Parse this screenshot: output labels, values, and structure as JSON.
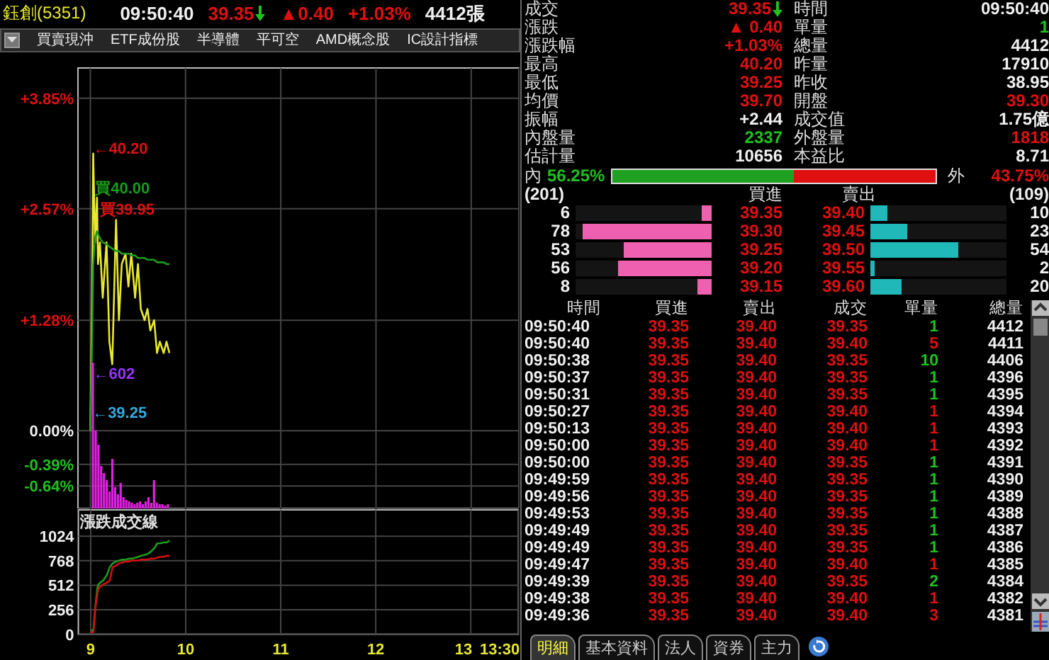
{
  "header": {
    "name": "鈺創(5351)",
    "time": "09:50:40",
    "price": "39.35",
    "falling": true,
    "change": "▲0.40",
    "change_pct": "+1.03%",
    "volume": "4412張"
  },
  "toolbar": [
    "買賣現沖",
    "ETF成份股",
    "半導體",
    "平可空",
    "AMD概念股",
    "IC設計指標"
  ],
  "price_chart": {
    "chart_data": {
      "type": "line",
      "grid": true,
      "x": [
        9,
        9.02,
        9.03,
        9.05,
        9.07,
        9.08,
        9.1,
        9.13,
        9.17,
        9.2,
        9.23,
        9.27,
        9.3,
        9.33,
        9.37,
        9.4,
        9.43,
        9.47,
        9.5,
        9.53,
        9.57,
        9.6,
        9.63,
        9.67,
        9.7,
        9.73,
        9.77,
        9.8,
        9.83
      ],
      "xlim": [
        8.87,
        13.5
      ],
      "ylim": [
        -0.9,
        4.2
      ],
      "yticks": [
        {
          "value": 3.85,
          "label": "+3.85%"
        },
        {
          "value": 2.57,
          "label": "+2.57%"
        },
        {
          "value": 1.28,
          "label": "+1.28%"
        },
        {
          "value": 0,
          "label": "0.00%"
        },
        {
          "value": -0.39,
          "label": "-0.39%"
        },
        {
          "value": -0.64,
          "label": "-0.64%"
        }
      ],
      "series": [
        {
          "color": "#e8e830",
          "values": [
            0,
            1.67,
            3.21,
            2.18,
            2.7,
            1.93,
            2.18,
            1.54,
            2.18,
            1.03,
            0.77,
            2.44,
            1.28,
            1.93,
            2.05,
            1.67,
            2.05,
            1.54,
            1.93,
            1.41,
            1.28,
            1.41,
            1.16,
            1.28,
            0.9,
            1.03,
            0.9,
            1.03,
            0.9
          ]
        },
        {
          "color": "#1e9a1e",
          "values": [
            0,
            1.16,
            1.93,
            2.23,
            2.31,
            2.28,
            2.23,
            2.18,
            2.16,
            2.13,
            2.11,
            2.08,
            2.08,
            2.05,
            2.05,
            2.05,
            2.03,
            2.03,
            2,
            2,
            2,
            1.98,
            1.98,
            1.98,
            1.95,
            1.95,
            1.95,
            1.93,
            1.93
          ]
        }
      ],
      "annotations": [
        {
          "text": "←40.20",
          "x": 9.03,
          "y": 3.21
        },
        {
          "text": "買40.00",
          "x": 9.05,
          "y": 2.75
        },
        {
          "text": "買39.95",
          "x": 9.1,
          "y": 2.5
        },
        {
          "text": "←602",
          "x": 9.03,
          "y": 0.6
        },
        {
          "text": "←39.25",
          "x": 9.02,
          "y": 0.15
        }
      ]
    }
  },
  "flow_chart": {
    "chart_data": {
      "type": "line",
      "title": "漲跌成交線",
      "x": [
        9,
        9.02,
        9.03,
        9.05,
        9.07,
        9.08,
        9.1,
        9.13,
        9.17,
        9.2,
        9.23,
        9.27,
        9.3,
        9.33,
        9.37,
        9.4,
        9.43,
        9.47,
        9.5,
        9.53,
        9.57,
        9.6,
        9.63,
        9.67,
        9.7,
        9.73,
        9.77,
        9.8,
        9.83
      ],
      "xlim": [
        8.87,
        13.5
      ],
      "ylim": [
        0,
        1300
      ],
      "grid": true,
      "xticks": [
        9,
        10,
        11,
        12,
        13,
        {
          "value": 13.5,
          "label": "13:30"
        }
      ],
      "yticks": [
        0,
        256,
        512,
        768,
        1024
      ],
      "series": [
        {
          "color": "#1e9a1e",
          "values": [
            40,
            40,
            60,
            300,
            480,
            520,
            540,
            560,
            620,
            700,
            740,
            760,
            770,
            780,
            780,
            790,
            790,
            800,
            810,
            820,
            830,
            840,
            860,
            900,
            950,
            950,
            960,
            960,
            980
          ]
        },
        {
          "color": "#d01010",
          "values": [
            20,
            20,
            30,
            280,
            420,
            470,
            500,
            520,
            540,
            560,
            700,
            720,
            740,
            750,
            760,
            760,
            770,
            770,
            770,
            780,
            780,
            780,
            790,
            790,
            800,
            810,
            810,
            820,
            820
          ]
        }
      ]
    }
  },
  "quote": [
    {
      "label": "成交",
      "value": "39.35",
      "color": "#e01010",
      "falling": true
    },
    {
      "label": "漲跌",
      "value": "▲ 0.40",
      "color": "#e01010"
    },
    {
      "label": "漲跌幅",
      "value": "+1.03%",
      "color": "#e01010"
    },
    {
      "label": "最高",
      "value": "40.20",
      "color": "#e01010"
    },
    {
      "label": "最低",
      "value": "39.25",
      "color": "#e01010"
    },
    {
      "label": "均價",
      "value": "39.70",
      "color": "#e01010"
    },
    {
      "label": "振幅",
      "value": "+2.44",
      "color": "#f0f0f0"
    },
    {
      "label": "內盤量",
      "value": "2337",
      "color": "#20c020"
    },
    {
      "label": "估計量",
      "value": "10656",
      "color": "#f0f0f0"
    },
    {
      "label": "時間",
      "value": "09:50:40",
      "color": "#f0f0f0"
    },
    {
      "label": "單量",
      "value": "1",
      "color": "#20c020"
    },
    {
      "label": "總量",
      "value": "4412",
      "color": "#f0f0f0"
    },
    {
      "label": "昨量",
      "value": "17910",
      "color": "#f0f0f0"
    },
    {
      "label": "昨收",
      "value": "38.95",
      "color": "#f0f0f0"
    },
    {
      "label": "開盤",
      "value": "39.30",
      "color": "#e01010"
    },
    {
      "label": "成交值",
      "value": "1.75億",
      "color": "#f0f0f0"
    },
    {
      "label": "外盤量",
      "value": "1818",
      "color": "#e01010"
    },
    {
      "label": "本益比",
      "value": "8.71",
      "color": "#f0f0f0"
    }
  ],
  "ratio": {
    "in_label": "內",
    "in_pct": "56.25%",
    "out_label": "外",
    "out_pct": "43.75%",
    "level": 0.5625
  },
  "order_book": {
    "bid_total": "(201)",
    "bid_label": "買進",
    "ask_label": "賣出",
    "ask_total": "(109)",
    "rows": [
      {
        "bid": {
          "qty": "6",
          "price": "39.35",
          "level": 0.07
        },
        "ask": {
          "qty": "10",
          "price": "39.40",
          "level": 0.12
        }
      },
      {
        "bid": {
          "qty": "78",
          "price": "39.30",
          "level": 0.95
        },
        "ask": {
          "qty": "23",
          "price": "39.45",
          "level": 0.27
        }
      },
      {
        "bid": {
          "qty": "53",
          "price": "39.25",
          "level": 0.65
        },
        "ask": {
          "qty": "54",
          "price": "39.50",
          "level": 0.65
        }
      },
      {
        "bid": {
          "qty": "56",
          "price": "39.20",
          "level": 0.69
        },
        "ask": {
          "qty": "2",
          "price": "39.55",
          "level": 0.03
        }
      },
      {
        "bid": {
          "qty": "8",
          "price": "39.15",
          "level": 0.1
        },
        "ask": {
          "qty": "20",
          "price": "39.60",
          "level": 0.23
        }
      }
    ]
  },
  "ticks": {
    "columns": [
      "時間",
      "買進",
      "賣出",
      "成交",
      "單量",
      "總量"
    ],
    "rows": [
      {
        "time": "09:50:40",
        "bid": "39.35",
        "ask": "39.40",
        "price": "39.35",
        "qty": "1",
        "color": "#20c020",
        "total": "4412"
      },
      {
        "time": "09:50:40",
        "bid": "39.35",
        "ask": "39.40",
        "price": "39.40",
        "qty": "5",
        "color": "#e01010",
        "total": "4411"
      },
      {
        "time": "09:50:38",
        "bid": "39.35",
        "ask": "39.40",
        "price": "39.35",
        "qty": "10",
        "color": "#20c020",
        "total": "4406"
      },
      {
        "time": "09:50:37",
        "bid": "39.35",
        "ask": "39.40",
        "price": "39.35",
        "qty": "1",
        "color": "#20c020",
        "total": "4396"
      },
      {
        "time": "09:50:31",
        "bid": "39.35",
        "ask": "39.40",
        "price": "39.35",
        "qty": "1",
        "color": "#20c020",
        "total": "4395"
      },
      {
        "time": "09:50:27",
        "bid": "39.35",
        "ask": "39.40",
        "price": "39.40",
        "qty": "1",
        "color": "#e01010",
        "total": "4394"
      },
      {
        "time": "09:50:13",
        "bid": "39.35",
        "ask": "39.40",
        "price": "39.40",
        "qty": "1",
        "color": "#e01010",
        "total": "4393"
      },
      {
        "time": "09:50:00",
        "bid": "39.35",
        "ask": "39.40",
        "price": "39.40",
        "qty": "1",
        "color": "#e01010",
        "total": "4392"
      },
      {
        "time": "09:50:00",
        "bid": "39.35",
        "ask": "39.40",
        "price": "39.35",
        "qty": "1",
        "color": "#20c020",
        "total": "4391"
      },
      {
        "time": "09:49:59",
        "bid": "39.35",
        "ask": "39.40",
        "price": "39.35",
        "qty": "1",
        "color": "#20c020",
        "total": "4390"
      },
      {
        "time": "09:49:56",
        "bid": "39.35",
        "ask": "39.40",
        "price": "39.35",
        "qty": "1",
        "color": "#20c020",
        "total": "4389"
      },
      {
        "time": "09:49:53",
        "bid": "39.35",
        "ask": "39.40",
        "price": "39.35",
        "qty": "1",
        "color": "#20c020",
        "total": "4388"
      },
      {
        "time": "09:49:49",
        "bid": "39.35",
        "ask": "39.40",
        "price": "39.35",
        "qty": "1",
        "color": "#20c020",
        "total": "4387"
      },
      {
        "time": "09:49:49",
        "bid": "39.35",
        "ask": "39.40",
        "price": "39.35",
        "qty": "1",
        "color": "#20c020",
        "total": "4386"
      },
      {
        "time": "09:49:47",
        "bid": "39.35",
        "ask": "39.40",
        "price": "39.40",
        "qty": "1",
        "color": "#e01010",
        "total": "4385"
      },
      {
        "time": "09:49:39",
        "bid": "39.35",
        "ask": "39.40",
        "price": "39.35",
        "qty": "2",
        "color": "#20c020",
        "total": "4384"
      },
      {
        "time": "09:49:38",
        "bid": "39.35",
        "ask": "39.40",
        "price": "39.40",
        "qty": "1",
        "color": "#e01010",
        "total": "4382"
      },
      {
        "time": "09:49:36",
        "bid": "39.35",
        "ask": "39.40",
        "price": "39.40",
        "qty": "3",
        "color": "#e01010",
        "total": "4381"
      }
    ]
  },
  "tabs": [
    {
      "label": "明細",
      "selected": true
    },
    {
      "label": "基本資料",
      "selected": false
    },
    {
      "label": "法人",
      "selected": false
    },
    {
      "label": "資券",
      "selected": false
    },
    {
      "label": "主力",
      "selected": false
    }
  ]
}
